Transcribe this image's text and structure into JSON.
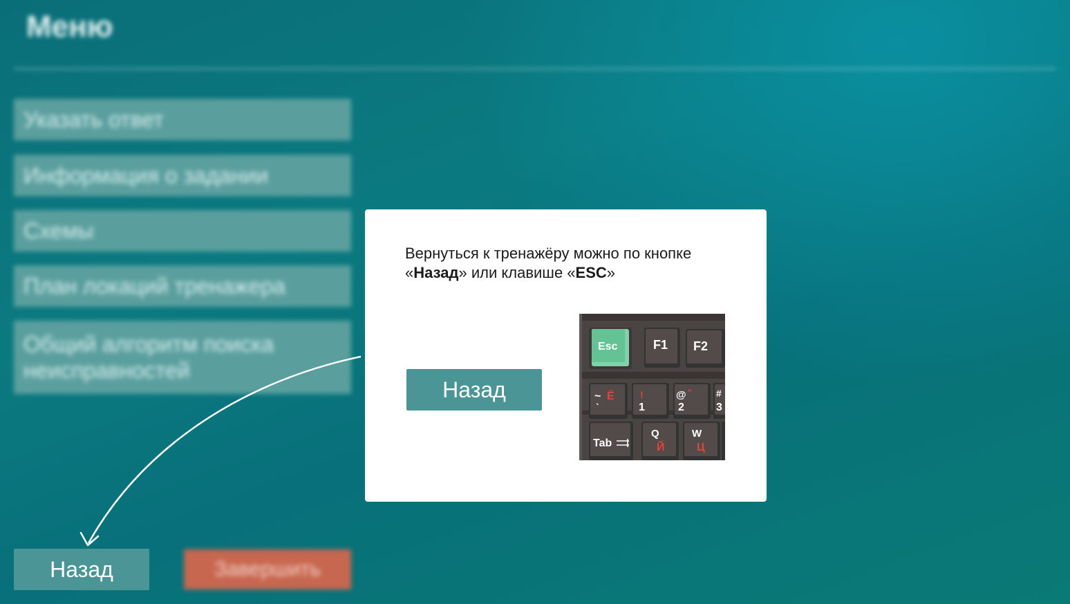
{
  "menu": {
    "title": "Меню",
    "items": [
      {
        "label": "Указать ответ"
      },
      {
        "label": "Информация о задании"
      },
      {
        "label": "Схемы"
      },
      {
        "label": "План локаций тренажера"
      },
      {
        "label": "Общий алгоритм поиска неисправностей"
      }
    ]
  },
  "footer": {
    "back_label": "Назад",
    "finish_label": "Завершить"
  },
  "dialog": {
    "text_part1": "Вернуться к тренажёру можно по кнопке «",
    "text_bold1": "Назад",
    "text_part2": "» или клавише «",
    "text_bold2": "ESC",
    "text_part3": "»",
    "back_button_label": "Назад",
    "keyboard": {
      "keys": {
        "esc": "Esc",
        "f1": "F1",
        "f2": "F2",
        "tilde": "~",
        "yo": "Ё",
        "backtick": "`",
        "excl": "!",
        "one": "1",
        "at": "@",
        "quote": "\"",
        "two": "2",
        "hash": "#",
        "three": "3",
        "tab": "Tab",
        "q": "Q",
        "yi": "Й",
        "w": "W",
        "ts": "Ц"
      }
    }
  },
  "colors": {
    "button": "#4c9596",
    "menu_item": "#5a9f9e",
    "finish": "#c8674f",
    "esc_key": "#6cc79c",
    "key": "#4e4746",
    "key_red": "#e0443a"
  }
}
